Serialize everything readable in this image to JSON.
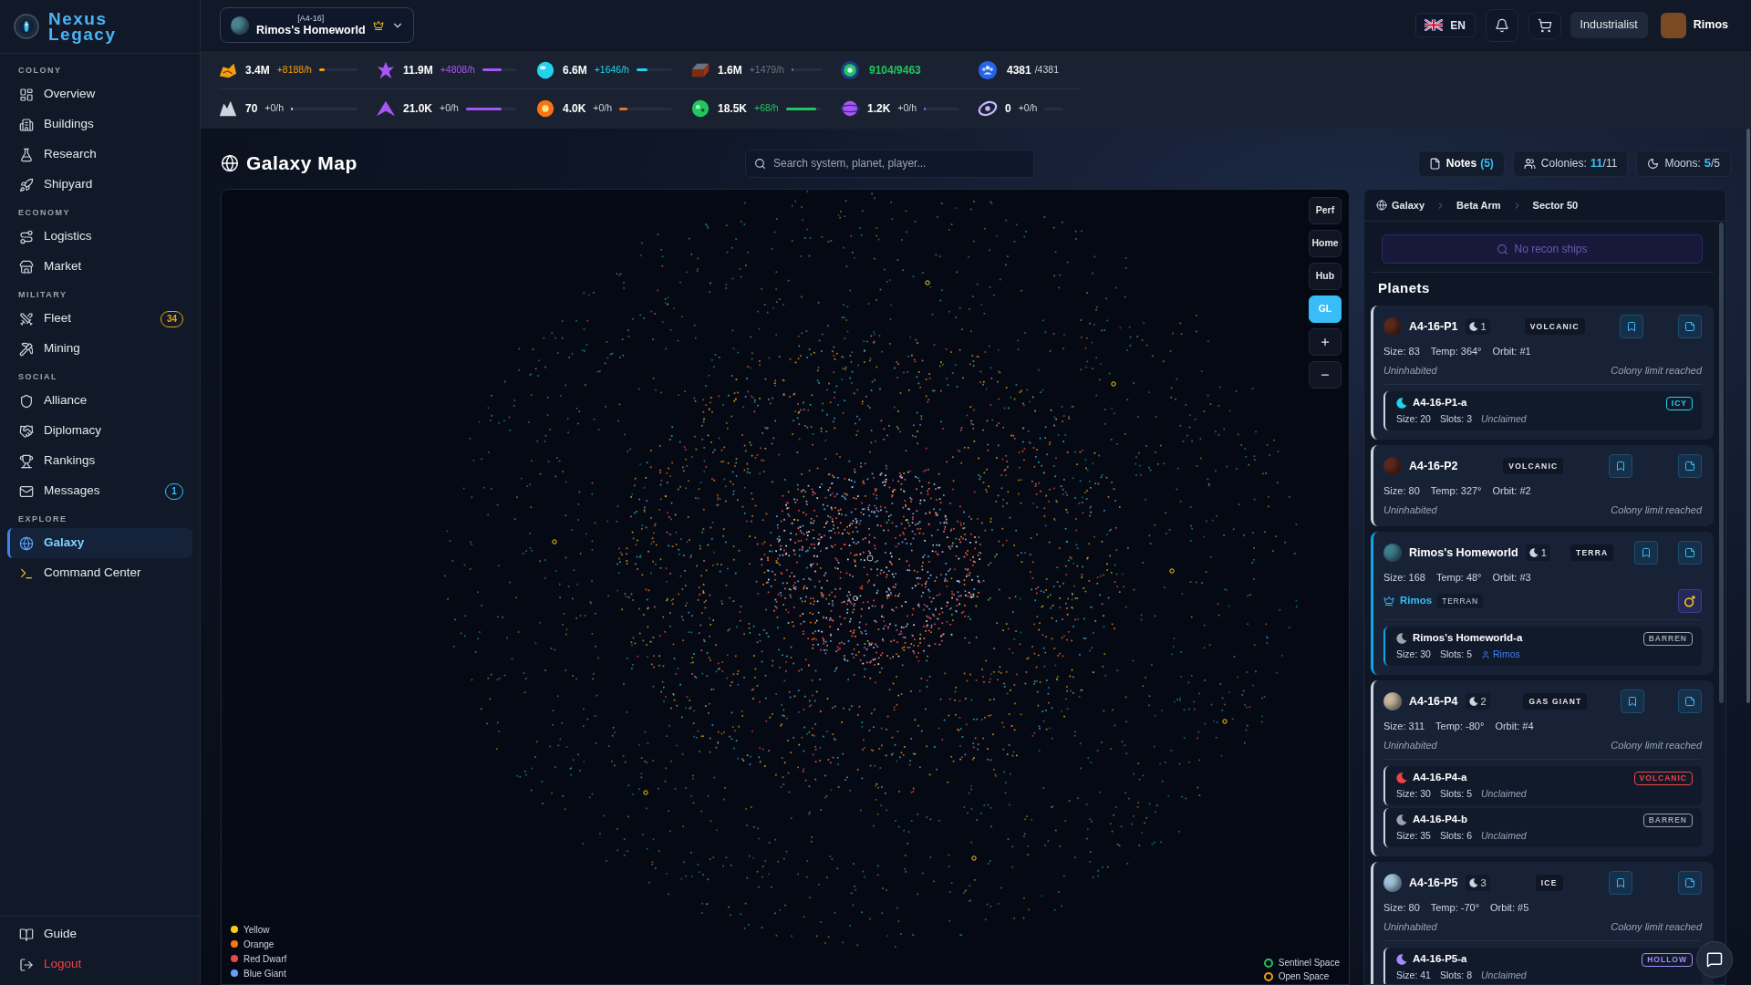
{
  "brand": {
    "title": "Nexus Legacy"
  },
  "sidebar": {
    "sections": [
      {
        "heading": "COLONY",
        "items": [
          {
            "label": "Overview",
            "selected": false
          },
          {
            "label": "Buildings",
            "selected": false
          },
          {
            "label": "Research",
            "selected": false
          },
          {
            "label": "Shipyard",
            "selected": false
          }
        ]
      },
      {
        "heading": "ECONOMY",
        "items": [
          {
            "label": "Logistics",
            "selected": false
          },
          {
            "label": "Market",
            "selected": false
          }
        ]
      },
      {
        "heading": "MILITARY",
        "items": [
          {
            "label": "Fleet",
            "selected": false,
            "badge": {
              "text": "34",
              "color": "#f59e0b"
            }
          },
          {
            "label": "Mining",
            "selected": false
          }
        ]
      },
      {
        "heading": "SOCIAL",
        "items": [
          {
            "label": "Alliance",
            "selected": false
          },
          {
            "label": "Diplomacy",
            "selected": false
          },
          {
            "label": "Rankings",
            "selected": false
          },
          {
            "label": "Messages",
            "selected": false,
            "badge": {
              "text": "1",
              "color": "#38bdf8"
            }
          }
        ]
      },
      {
        "heading": "EXPLORE",
        "items": [
          {
            "label": "Galaxy",
            "selected": true
          },
          {
            "label": "Command Center",
            "selected": false
          }
        ]
      }
    ],
    "footer": [
      {
        "label": "Guide",
        "kind": "link"
      },
      {
        "label": "Logout",
        "kind": "danger"
      }
    ]
  },
  "header": {
    "colony": {
      "code": "[A4-16]",
      "name": "Rimos's Homeworld"
    },
    "language": "EN",
    "rank": "Industrialist",
    "user": "Rimos"
  },
  "resources": [
    {
      "kind": "rate",
      "amount": "3.4M",
      "rate": "+8188/h",
      "growing": true,
      "color": "#f59e0b",
      "level": 0.15
    },
    {
      "kind": "rate",
      "amount": "11.9M",
      "rate": "+4808/h",
      "growing": true,
      "color": "#a855f7",
      "level": 0.55
    },
    {
      "kind": "rate",
      "amount": "6.6M",
      "rate": "+1646/h",
      "growing": true,
      "color": "#22d3ee",
      "level": 0.3
    },
    {
      "kind": "rate",
      "amount": "1.6M",
      "rate": "+1479/h",
      "growing": true,
      "color": "#6b7280",
      "level": 0.05
    },
    {
      "kind": "energy",
      "value": "9104/9463",
      "color": "#22c55e"
    },
    {
      "kind": "population",
      "value": "4381",
      "max": "/4381"
    },
    {
      "kind": "rate",
      "amount": "70",
      "rate": "+0/h",
      "growing": false,
      "color": "#cbd5e1",
      "level": 0.03
    },
    {
      "kind": "rate",
      "amount": "21.0K",
      "rate": "+0/h",
      "growing": false,
      "color": "#a855f7",
      "level": 0.7
    },
    {
      "kind": "rate",
      "amount": "4.0K",
      "rate": "+0/h",
      "growing": false,
      "color": "#f97316",
      "level": 0.15
    },
    {
      "kind": "rate",
      "amount": "18.5K",
      "rate": "+68/h",
      "growing": true,
      "color": "#22c55e",
      "level": 0.85
    },
    {
      "kind": "rate",
      "amount": "1.2K",
      "rate": "+0/h",
      "growing": false,
      "color": "#a855f7",
      "level": 0.05
    },
    {
      "kind": "rate",
      "amount": "0",
      "rate": "+0/h",
      "growing": false,
      "color": "#c4b5fd"
    }
  ],
  "page": {
    "title": "Galaxy Map",
    "search": {
      "placeholder": "Search system, planet, player..."
    },
    "stats": [
      {
        "kind": "notes",
        "label": "Notes",
        "value": "(5)"
      },
      {
        "kind": "count",
        "label": "Colonies:",
        "value": "11",
        "max": "/11"
      },
      {
        "kind": "count",
        "label": "Moons:",
        "value": "5",
        "max": "/5"
      }
    ]
  },
  "map": {
    "view_buttons": [
      {
        "label": "Perf",
        "selected": false
      },
      {
        "label": "Home",
        "selected": false
      },
      {
        "label": "Hub",
        "selected": false
      },
      {
        "label": "GL",
        "selected": true
      }
    ],
    "star_legend": [
      {
        "label": "Yellow",
        "color": "#facc15"
      },
      {
        "label": "Orange",
        "color": "#f97316"
      },
      {
        "label": "Red Dwarf",
        "color": "#ef4444"
      },
      {
        "label": "Blue Giant",
        "color": "#60a5fa"
      }
    ],
    "zone_legend": [
      {
        "label": "Sentinel Space",
        "color": "#22c55e"
      },
      {
        "label": "Open Space",
        "color": "#f59e0b"
      }
    ]
  },
  "system_panel": {
    "breadcrumb": [
      "Galaxy",
      "Beta Arm",
      "Sector 50"
    ],
    "recon": {
      "label": "No recon ships",
      "disabled": true
    },
    "heading": "Planets",
    "planets": [
      {
        "name": "A4-16-P1",
        "moon_count": "1",
        "type": "VOLCANIC",
        "color": "#5b2a1c",
        "selected": false,
        "size": "Size: 83",
        "temp": "Temp: 364°",
        "orbit": "Orbit: #1",
        "status": "Uninhabited",
        "note": "Colony limit reached",
        "moons": [
          {
            "name": "A4-16-P1-a",
            "type": "ICY",
            "color": "#22d3ee",
            "size": "Size: 20",
            "slots": "Slots: 3",
            "status": "Unclaimed"
          }
        ]
      },
      {
        "name": "A4-16-P2",
        "type": "VOLCANIC",
        "color": "#5b2a1c",
        "selected": false,
        "size": "Size: 80",
        "temp": "Temp: 327°",
        "orbit": "Orbit: #2",
        "status": "Uninhabited",
        "note": "Colony limit reached"
      },
      {
        "name": "Rimos's Homeworld",
        "moon_count": "1",
        "type": "TERRA",
        "color": "#3e7f8f",
        "selected": true,
        "size": "Size: 168",
        "temp": "Temp: 48°",
        "orbit": "Orbit: #3",
        "owner": {
          "name": "Rimos",
          "race": "TERRAN"
        },
        "moons": [
          {
            "name": "Rimos's Homeworld-a",
            "type": "BARREN",
            "color": "#9ca3af",
            "size": "Size: 30",
            "slots": "Slots: 5",
            "owner": "Rimos"
          }
        ]
      },
      {
        "name": "A4-16-P4",
        "moon_count": "2",
        "type": "GAS GIANT",
        "color": "#c8b79c",
        "selected": false,
        "size": "Size: 311",
        "temp": "Temp: -80°",
        "orbit": "Orbit: #4",
        "status": "Uninhabited",
        "note": "Colony limit reached",
        "moons": [
          {
            "name": "A4-16-P4-a",
            "type": "VOLCANIC",
            "color": "#ef4444",
            "size": "Size: 30",
            "slots": "Slots: 5",
            "status": "Unclaimed"
          },
          {
            "name": "A4-16-P4-b",
            "type": "BARREN",
            "color": "#9ca3af",
            "size": "Size: 35",
            "slots": "Slots: 6",
            "status": "Unclaimed"
          }
        ]
      },
      {
        "name": "A4-16-P5",
        "moon_count": "3",
        "type": "ICE",
        "color": "#9fc4dc",
        "selected": false,
        "size": "Size: 80",
        "temp": "Temp: -70°",
        "orbit": "Orbit: #5",
        "status": "Uninhabited",
        "note": "Colony limit reached",
        "moons": [
          {
            "name": "A4-16-P5-a",
            "type": "HOLLOW",
            "color": "#a78bfa",
            "size": "Size: 41",
            "slots": "Slots: 8",
            "status": "Unclaimed"
          }
        ]
      }
    ]
  }
}
